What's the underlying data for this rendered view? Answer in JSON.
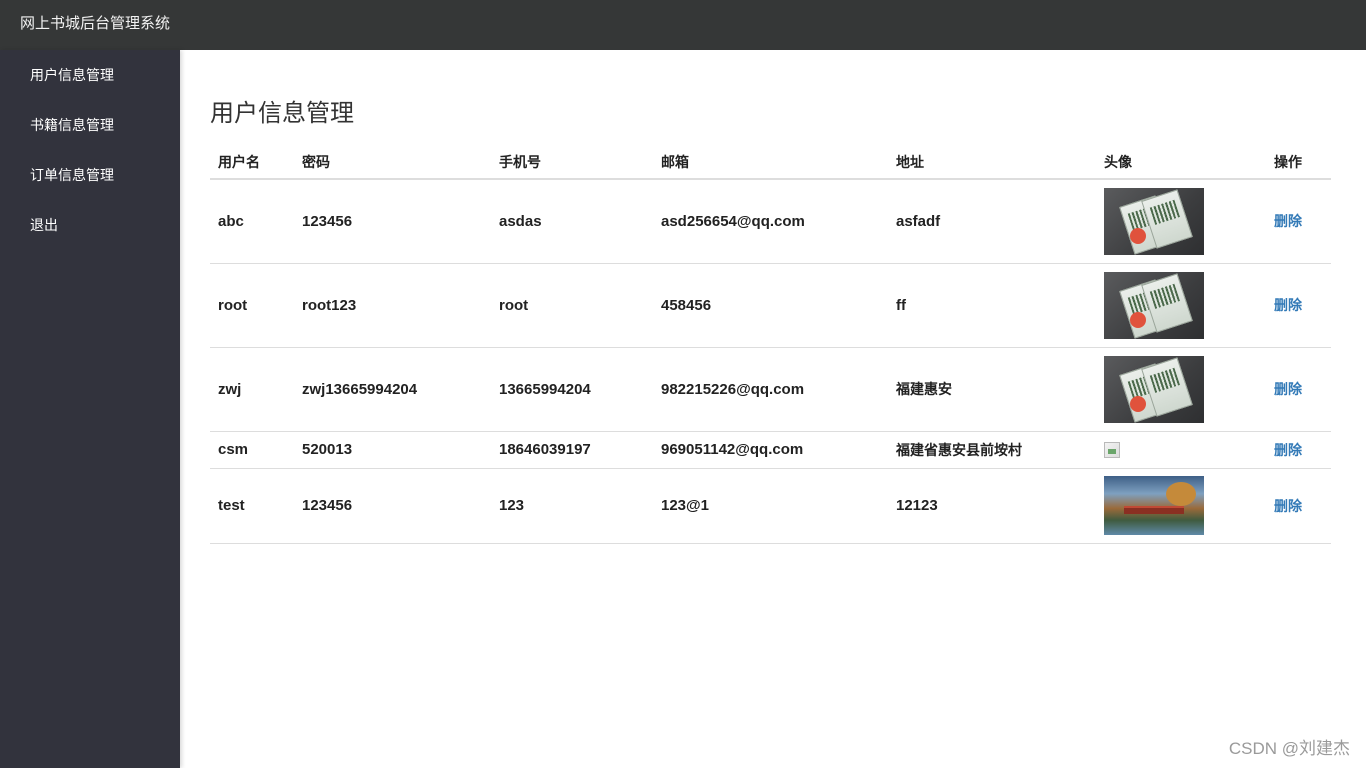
{
  "app": {
    "title": "网上书城后台管理系统"
  },
  "sidebar": {
    "items": [
      {
        "label": "用户信息管理"
      },
      {
        "label": "书籍信息管理"
      },
      {
        "label": "订单信息管理"
      },
      {
        "label": "退出"
      }
    ]
  },
  "main": {
    "title": "用户信息管理",
    "table": {
      "headers": [
        "用户名",
        "密码",
        "手机号",
        "邮箱",
        "地址",
        "头像",
        "操作"
      ],
      "rows": [
        {
          "username": "abc",
          "password": "123456",
          "phone": "asdas",
          "email": "asd256654@qq.com",
          "address": "asfadf",
          "avatar": "books-photo",
          "action": "删除"
        },
        {
          "username": "root",
          "password": "root123",
          "phone": "root",
          "email": "458456",
          "address": "ff",
          "avatar": "books-photo",
          "action": "删除"
        },
        {
          "username": "zwj",
          "password": "zwj13665994204",
          "phone": "13665994204",
          "email": "982215226@qq.com",
          "address": "福建惠安",
          "avatar": "books-photo",
          "action": "删除"
        },
        {
          "username": "csm",
          "password": "520013",
          "phone": "18646039197",
          "email": "969051142@qq.com",
          "address": "福建省惠安县前垵村",
          "avatar": "broken-image-icon",
          "action": "删除"
        },
        {
          "username": "test",
          "password": "123456",
          "phone": "123",
          "email": "123@1",
          "address": "12123",
          "avatar": "scenic-photo",
          "action": "删除"
        }
      ]
    }
  },
  "watermark": "CSDN @刘建杰",
  "colors": {
    "topbar": "#353737",
    "sidebar": "#32333d",
    "link": "#337ab7"
  }
}
